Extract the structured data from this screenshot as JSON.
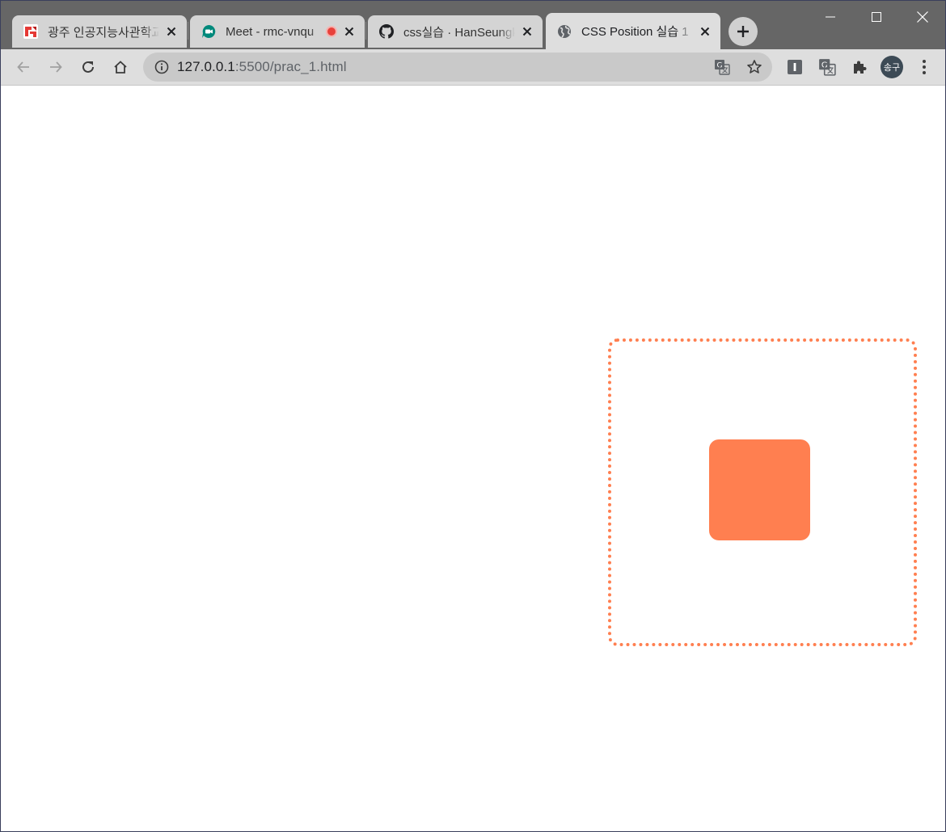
{
  "tabs": [
    {
      "title": "광주 인공지능사관학교",
      "favicon": "gwangju-ai-favicon-icon",
      "active": false
    },
    {
      "title": "Meet - rmc-vnqu",
      "favicon": "google-meet-icon",
      "active": false,
      "recording": true
    },
    {
      "title": "css실습 · HanSeungku",
      "favicon": "github-icon",
      "active": false
    },
    {
      "title": "CSS Position 실습 1",
      "favicon": "globe-icon",
      "active": true
    }
  ],
  "address_bar": {
    "host": "127.0.0.1",
    "path": ":5500/prac_1.html"
  },
  "profile": {
    "initials": "송구"
  },
  "page": {
    "accent_color": "#ff7f50",
    "parent_border_style": "dotted"
  }
}
